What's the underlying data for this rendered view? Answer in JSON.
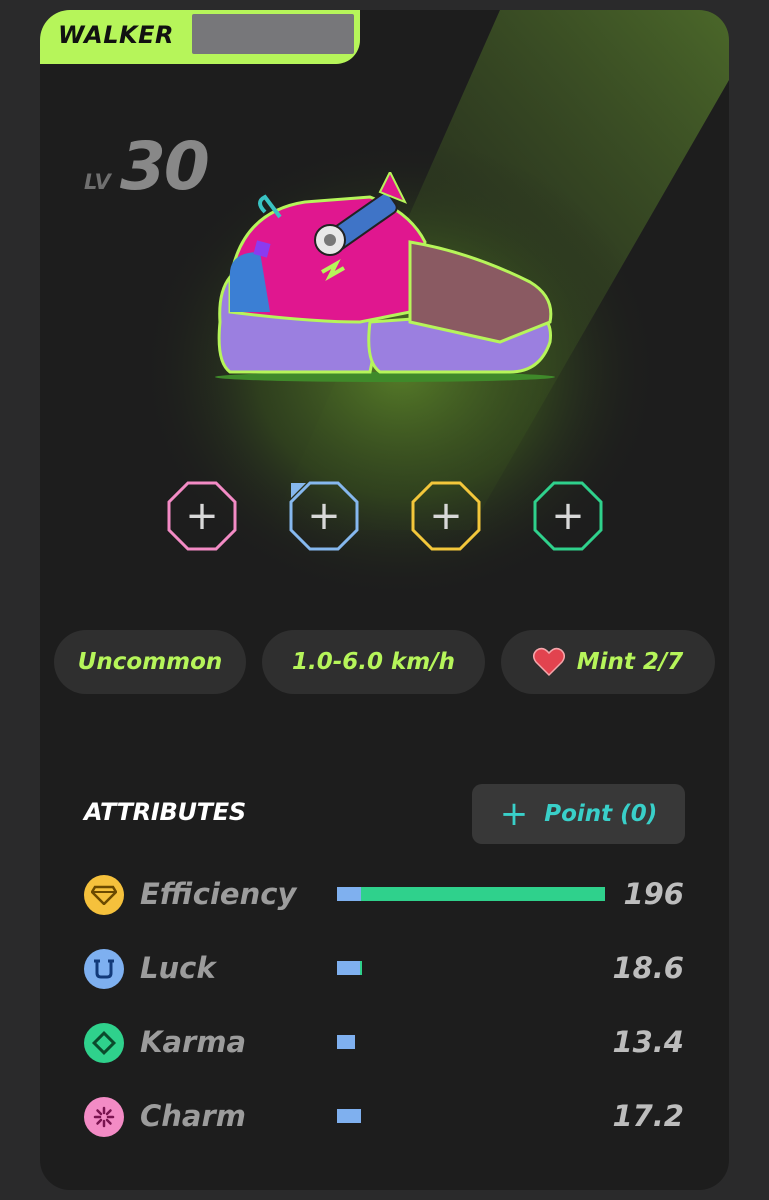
{
  "header": {
    "type_label": "WALKER"
  },
  "level": {
    "prefix": "LV",
    "value": "30"
  },
  "sockets": [
    {
      "name": "socket-pink",
      "color": "#f38bc5",
      "symbol": "+"
    },
    {
      "name": "socket-blue",
      "color": "#86b8ee",
      "symbol": "+"
    },
    {
      "name": "socket-yellow",
      "color": "#f3c73b",
      "symbol": "+"
    },
    {
      "name": "socket-green",
      "color": "#2fd18c",
      "symbol": "+"
    }
  ],
  "info": {
    "rarity": "Uncommon",
    "speed_range": "1.0-6.0 km/h",
    "mint": "Mint 2/7",
    "accent": "#b6f55a"
  },
  "attributes": {
    "title": "ATTRIBUTES",
    "point_button": "Point (0)",
    "items": [
      {
        "name": "Efficiency",
        "value": "196",
        "base": 0.09,
        "total": 1.0,
        "icon": "gem-icon",
        "color": "#f5c13c"
      },
      {
        "name": "Luck",
        "value": "18.6",
        "base": 0.085,
        "total": 0.095,
        "icon": "horseshoe-icon",
        "color": "#7eb0f0"
      },
      {
        "name": "Karma",
        "value": "13.4",
        "base": 0.068,
        "total": 0.068,
        "icon": "diamond-icon",
        "color": "#2fd18c"
      },
      {
        "name": "Charm",
        "value": "17.2",
        "base": 0.088,
        "total": 0.088,
        "icon": "sparkle-icon",
        "color": "#f38bc5"
      }
    ]
  }
}
